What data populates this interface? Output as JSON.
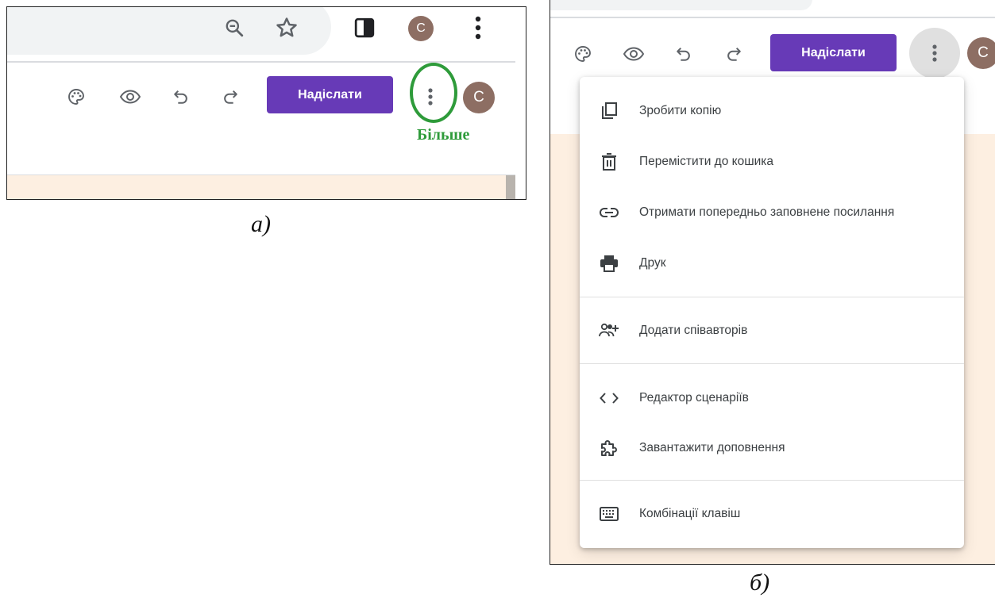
{
  "panel_a": {
    "browser": {
      "zoom_icon": "zoom-out-icon",
      "star_icon": "bookmark-star-icon",
      "side_panel_icon": "side-panel-icon",
      "avatar_letter": "C",
      "menu_icon": "vertical-dots-icon"
    },
    "toolbar": {
      "icons": [
        "palette-icon",
        "eye-icon",
        "undo-icon",
        "redo-icon"
      ],
      "send_label": "Надіслати",
      "more_icon": "vertical-dots-icon",
      "avatar_letter": "C"
    },
    "annotation": "Більше",
    "caption": "а)"
  },
  "panel_b": {
    "toolbar": {
      "send_label": "Надіслати",
      "avatar_letter": "C"
    },
    "menu": {
      "items": [
        {
          "label": "Зробити копію",
          "icon": "copy-icon"
        },
        {
          "label": "Перемістити до кошика",
          "icon": "trash-icon"
        },
        {
          "label": "Отримати попередньо заповнене посилання",
          "icon": "link-icon"
        },
        {
          "label": "Друк",
          "icon": "print-icon"
        },
        {
          "label": "Додати співавторів",
          "icon": "add-people-icon"
        },
        {
          "label": "Редактор сценаріїв",
          "icon": "code-icon"
        },
        {
          "label": "Завантажити доповнення",
          "icon": "puzzle-icon"
        },
        {
          "label": "Комбінації клавіш",
          "icon": "keyboard-icon"
        }
      ]
    },
    "caption": "б)"
  },
  "colors": {
    "accent": "#673ab7",
    "avatar": "#8d6e63",
    "annotation": "#2e9b3a",
    "form_background": "#fdefe1"
  }
}
